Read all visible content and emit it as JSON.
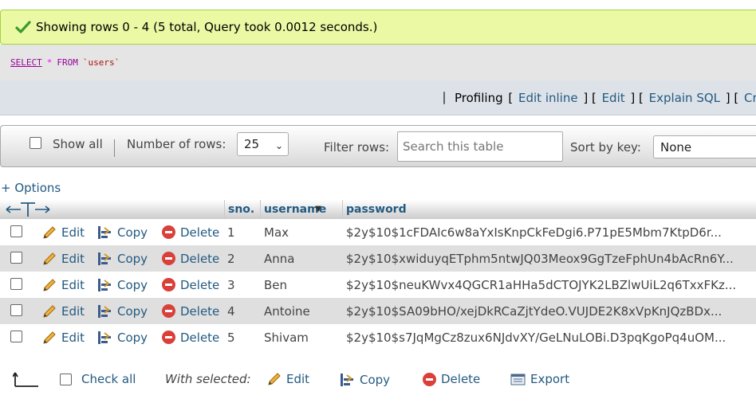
{
  "success": {
    "message": "Showing rows 0 - 4 (5 total, Query took 0.0012 seconds.)",
    "icon": "checkmark-icon"
  },
  "sql": {
    "select": "SELECT",
    "star": "*",
    "from": "FROM",
    "table": "`users`"
  },
  "tools": {
    "profiling": "Profiling",
    "edit_inline": "Edit inline",
    "edit": "Edit",
    "explain": "Explain SQL",
    "create": "Crea"
  },
  "nav": {
    "show_all": "Show all",
    "number_of_rows_label": "Number of rows:",
    "number_of_rows_value": "25",
    "filter_label": "Filter rows:",
    "filter_placeholder": "Search this table",
    "sort_label": "Sort by key:",
    "sort_value": "None"
  },
  "options_label": "+ Options",
  "table": {
    "columns": [
      "sno.",
      "username",
      "password"
    ],
    "action_labels": {
      "edit": "Edit",
      "copy": "Copy",
      "delete": "Delete"
    },
    "rows": [
      {
        "sno": "1",
        "username": "Max",
        "password": "$2y$10$1cFDAIc6w8aYxIsKnpCkFeDgi6.P71pE5Mbm7KtpD6r..."
      },
      {
        "sno": "2",
        "username": "Anna",
        "password": "$2y$10$xwiduyqETphm5ntwJQ03Meox9GgTzeFphUn4bAcRn6Y..."
      },
      {
        "sno": "3",
        "username": "Ben",
        "password": "$2y$10$neuKWvx4QGCR1aHHa5dCTOJYK2LBZlwUiL2q6TxxFKz..."
      },
      {
        "sno": "4",
        "username": "Antoine",
        "password": "$2y$10$SA09bHO/xejDkRCaZjtYdeO.VUJDE2K8xVpKnJQzBDx..."
      },
      {
        "sno": "5",
        "username": "Shivam",
        "password": "$2y$10$s7JqMgCz8zux6NJdvXY/GeLNuLOBi.D3pqKgoPq4uOM..."
      }
    ]
  },
  "footer": {
    "check_all": "Check all",
    "with_selected": "With selected:",
    "edit": "Edit",
    "copy": "Copy",
    "delete": "Delete",
    "export": "Export"
  },
  "colors": {
    "link": "#235a81",
    "success_bg": "#ebf8a4",
    "delete_red": "#d9403a"
  }
}
